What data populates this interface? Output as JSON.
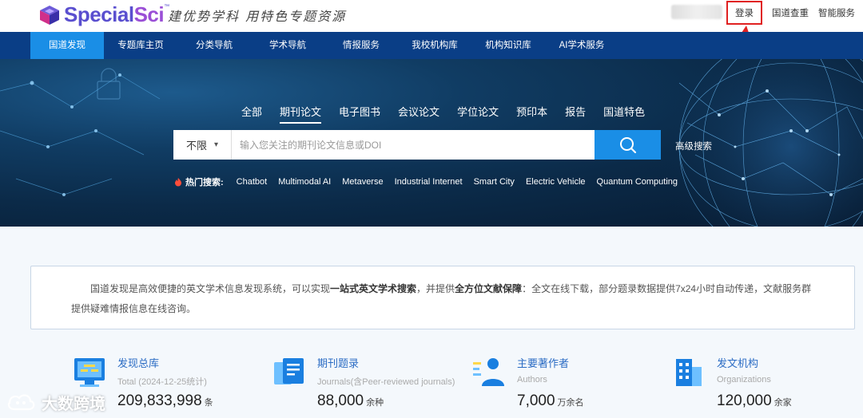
{
  "header": {
    "logo_text_a": "Special",
    "logo_text_b": "Sci",
    "logo_tm": "™",
    "slogan": "建优势学科 用特色专题资源",
    "links": [
      "登录",
      "国道查重",
      "智能服务"
    ]
  },
  "nav": {
    "items": [
      "国道发现",
      "专题库主页",
      "分类导航",
      "学术导航",
      "情报服务",
      "我校机构库",
      "机构知识库",
      "AI学术服务"
    ],
    "active_index": 0
  },
  "search": {
    "tabs": [
      "全部",
      "期刊论文",
      "电子图书",
      "会议论文",
      "学位论文",
      "预印本",
      "报告",
      "国道特色"
    ],
    "active_tab": 1,
    "scope": "不限",
    "placeholder": "输入您关注的期刊论文信息或DOI",
    "advanced": "高级搜索",
    "hot_label": "热门搜索:",
    "hot_terms": [
      "Chatbot",
      "Multimodal AI",
      "Metaverse",
      "Industrial Internet",
      "Smart City",
      "Electric Vehicle",
      "Quantum Computing"
    ]
  },
  "intro": {
    "p1": "国道发现是高效便捷的英文学术信息发现系统，可以实现",
    "b1": "一站式英文学术搜索",
    "p2": "，并提供",
    "b2": "全方位文献保障",
    "p3": "：全文在线下载，部分题录数据提供7x24小时自动传递，文献服务群提供疑难情报信息在线咨询。"
  },
  "stats": [
    {
      "title": "发现总库",
      "sub": "Total (2024-12-25统计)",
      "num": "209,833,998",
      "unit": "条",
      "icon": "database-monitor-icon"
    },
    {
      "title": "期刊题录",
      "sub": "Journals(含Peer-reviewed journals)",
      "num": "88,000",
      "unit": "余种",
      "icon": "journal-book-icon"
    },
    {
      "title": "主要著作者",
      "sub": "Authors",
      "num": "7,000",
      "unit": "万余名",
      "icon": "author-person-icon"
    },
    {
      "title": "发文机构",
      "sub": "Organizations",
      "num": "120,000",
      "unit": "余家",
      "icon": "organization-building-icon"
    }
  ],
  "watermark": "大数跨境",
  "colors": {
    "nav_bg": "#0a3e86",
    "nav_active": "#1a8ee6",
    "search_button": "#1a8ee6",
    "login_highlight": "#e02020",
    "stat_title": "#2b6cc4"
  }
}
